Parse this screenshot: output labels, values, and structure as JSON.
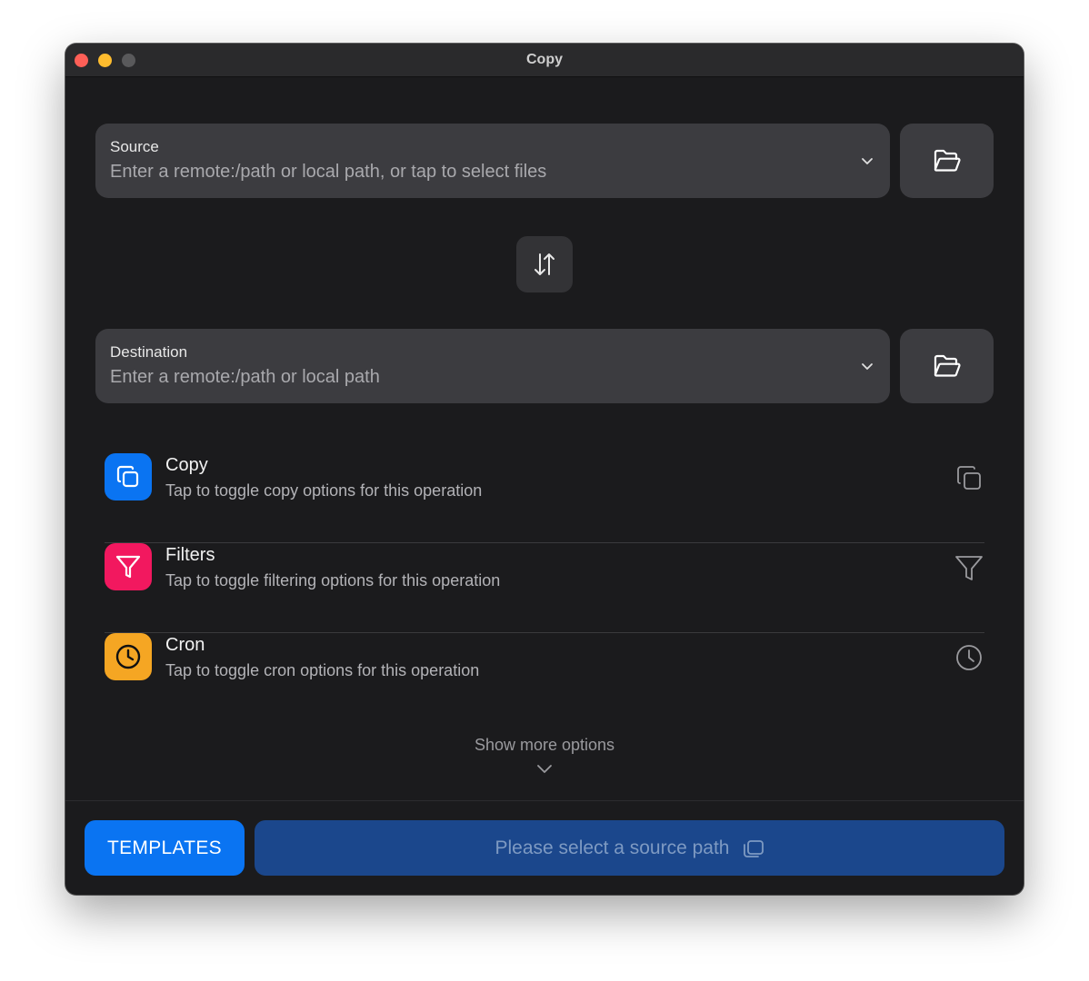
{
  "window": {
    "title": "Copy"
  },
  "source": {
    "label": "Source",
    "placeholder": "Enter a remote:/path or local path, or tap to select files",
    "chevron_icon": "chevron-down-icon",
    "browse_icon": "folder-open-icon"
  },
  "swap": {
    "icon": "swap-arrows-icon"
  },
  "destination": {
    "label": "Destination",
    "placeholder": "Enter a remote:/path or local path",
    "chevron_icon": "chevron-down-icon",
    "browse_icon": "folder-open-icon"
  },
  "options": [
    {
      "title": "Copy",
      "subtitle": "Tap to toggle copy options for this operation",
      "icon": "copy-icon",
      "color": "#0a74f2"
    },
    {
      "title": "Filters",
      "subtitle": "Tap to toggle filtering options for this operation",
      "icon": "filter-icon",
      "color": "#f2185f"
    },
    {
      "title": "Cron",
      "subtitle": "Tap to toggle cron options for this operation",
      "icon": "clock-icon",
      "color": "#f5a623"
    }
  ],
  "more": {
    "label": "Show more options",
    "icon": "chevron-down-icon"
  },
  "footer": {
    "templates_label": "TEMPLATES",
    "run_label": "Please select a source path",
    "run_icon": "copy-icon",
    "templates_color": "#0a74f2",
    "run_color": "#1b478c"
  }
}
